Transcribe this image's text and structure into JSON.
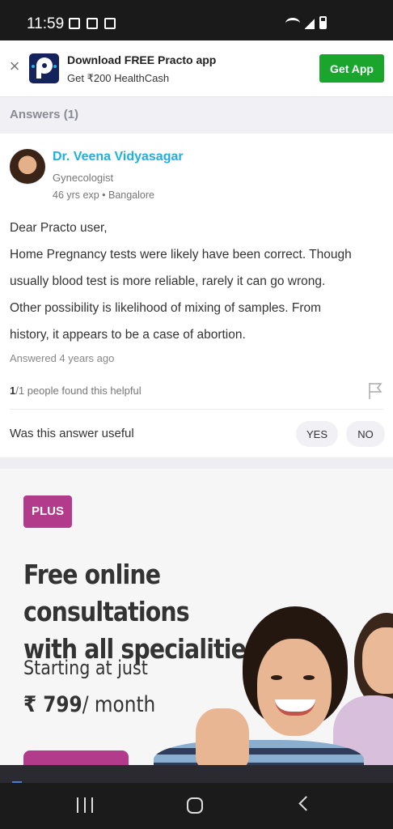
{
  "status_bar": {
    "time": "11:59",
    "icons_left": [
      "calendar-icon",
      "image-icon",
      "camera-icon"
    ],
    "icons_right": [
      "wifi-icon",
      "signal-icon",
      "battery-icon"
    ]
  },
  "app_banner": {
    "title": "Download FREE Practo app",
    "subtitle": "Get ₹200 HealthCash",
    "button_label": "Get App",
    "close_glyph": "×",
    "button_color": "#1aa52d"
  },
  "answers_header": {
    "label": "Answers (1)"
  },
  "answer": {
    "doctor_name": "Dr. Veena Vidyasagar",
    "specialty": "Gynecologist",
    "meta": "46 yrs exp • Bangalore",
    "text_lines": [
      "Dear Practo user,",
      "Home Pregnancy tests were likely have been correct. Though",
      "usually blood test is more reliable, rarely it can go wrong.",
      "Other possibility is likelihood of mixing of samples. From",
      "history, it appears to be a case of abortion."
    ],
    "answered": "Answered  4 years ago",
    "helpful_count": "1",
    "helpful_rest": "/1 people found this helpful",
    "useful_question": "Was this answer useful",
    "yes_label": "YES",
    "no_label": "NO",
    "name_color": "#1fb0e0"
  },
  "promo": {
    "badge": "PLUS",
    "headline_line1": "Free online consultations",
    "headline_line2": "with all specialities",
    "starting": "Starting at just",
    "price": "₹ 799",
    "per": "/ month",
    "badge_color": "#b23c8b"
  },
  "nav_bar": {
    "icons": [
      "recent-apps-icon",
      "home-icon",
      "back-icon"
    ]
  }
}
